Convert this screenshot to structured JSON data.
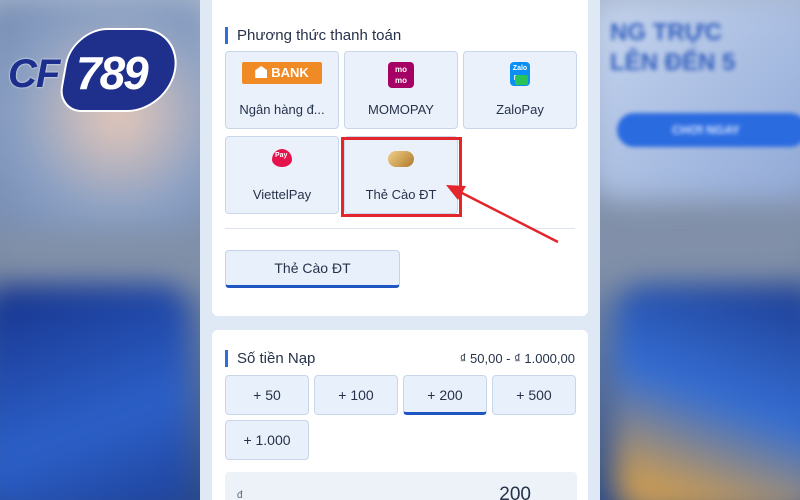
{
  "logo": {
    "prefix": "CF",
    "number": "789"
  },
  "background": {
    "promo_text_1": "NG TRỰC",
    "promo_text_2": "LÊN ĐẾN 5",
    "promo_button": "CHƠI NGAY"
  },
  "payment": {
    "title": "Phương thức thanh toán",
    "methods": [
      {
        "label": "Ngân hàng đ...",
        "icon": "bank-icon",
        "icon_text": "BANK"
      },
      {
        "label": "MOMOPAY",
        "icon": "momo-icon",
        "icon_text": "mo mo"
      },
      {
        "label": "ZaloPay",
        "icon": "zalopay-icon",
        "icon_text": "Zalo Pay"
      },
      {
        "label": "ViettelPay",
        "icon": "viettelpay-icon",
        "icon_text": "Pay"
      },
      {
        "label": "Thẻ Cào ĐT",
        "icon": "phone-card-icon",
        "icon_text": ""
      }
    ],
    "selected_method": "Thẻ Cào ĐT",
    "subtab": "Thẻ Cào ĐT"
  },
  "deposit": {
    "title": "Số tiền Nạp",
    "range": "₫ 50,00 - ₫ 1.000,00",
    "amounts": [
      "+ 50",
      "+ 100",
      "+ 200",
      "+ 500",
      "+ 1.000"
    ],
    "selected_amount": "+ 200",
    "currency_symbol": "đ",
    "input_value": "200"
  },
  "colors": {
    "accent": "#1f56c2",
    "highlight": "#e3262b",
    "brand": "#1f2f8c"
  }
}
